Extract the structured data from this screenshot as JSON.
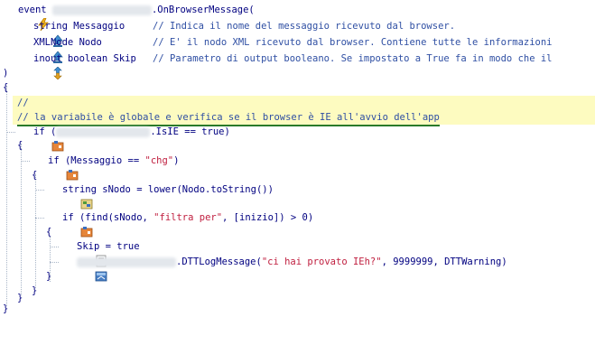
{
  "editor": {
    "signature": {
      "keyword": "event",
      "object": "blurred-object",
      "method": ".OnBrowserMessage("
    },
    "params": [
      {
        "icon": "param-in-icon",
        "text": "string Messaggio",
        "comment": "// Indica il nome del messaggio ricevuto dal browser."
      },
      {
        "icon": "param-in-icon",
        "text": "XMLNode Nodo",
        "comment": "// E' il nodo XML ricevuto dal browser. Contiene tutte le informazioni"
      },
      {
        "icon": "param-inout-icon",
        "text": "inout boolean Skip",
        "comment": "// Parametro di output booleano. Se impostato a True fa in modo che il"
      }
    ],
    "close_paren": ")",
    "open_brace": "{",
    "comment_1": "//",
    "comment_2": "// la variabile è globale e verifica se il browser è IE all'avvio dell'app",
    "if1_kw": "if",
    "if1_open": "(",
    "if1_prop": ".IsIE",
    "if1_rest": " == true)",
    "brace_open_1": "{",
    "if2_kw": "if",
    "if2_cond_a": "(Messaggio == ",
    "if2_str": "\"chg\"",
    "if2_cond_b": ")",
    "brace_open_2": "{",
    "decl_kw": "string",
    "decl_rest": " sNodo = lower(Nodo.toString())",
    "if3_kw": "if",
    "if3_a": "(find(sNodo, ",
    "if3_str": "\"filtra per\"",
    "if3_b": ", [inizio]) > 0)",
    "brace_open_3": "{",
    "assign": "Skip = true",
    "log_call": ".DTTLogMessage(",
    "log_str": "\"ci hai provato IEh?\"",
    "log_rest": ", 9999999, DTTWarning)",
    "brace_close_3": "}",
    "brace_close_2": "}",
    "brace_close_1": "}",
    "brace_close_0": "}"
  },
  "colors": {
    "keyword": "#000080",
    "comment": "#2f4fa3",
    "string": "#c02040",
    "highlight": "#fdfbc0"
  }
}
